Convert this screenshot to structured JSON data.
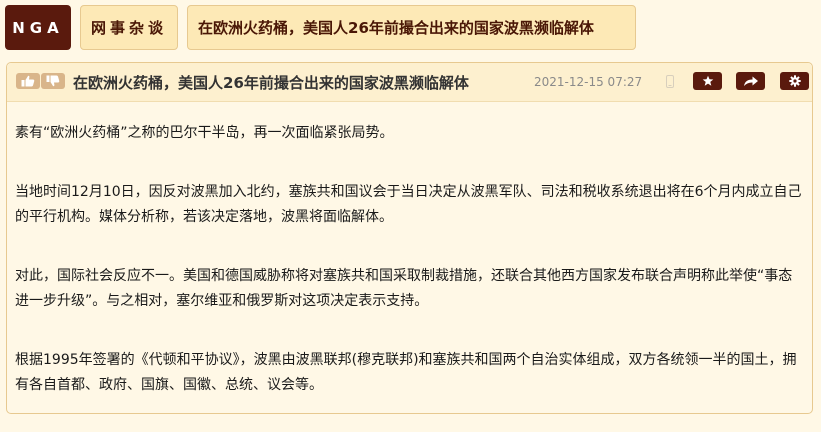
{
  "breadcrumb": {
    "site": "NGA",
    "forum": "网事杂谈",
    "thread_title": "在欧洲火药桶，美国人26年前撮合出来的国家波黑濒临解体"
  },
  "post": {
    "title": "在欧洲火药桶，美国人26年前撮合出来的国家波黑濒临解体",
    "time": "2021-12-15 07:27",
    "paragraphs": [
      "素有“欧洲火药桶”之称的巴尔干半岛，再一次面临紧张局势。",
      "当地时间12月10日，因反对波黑加入北约，塞族共和国议会于当日决定从波黑军队、司法和税收系统退出将在6个月内成立自己的平行机构。媒体分析称，若该决定落地，波黑将面临解体。",
      "对此，国际社会反应不一。美国和德国威胁称将对塞族共和国采取制裁措施，还联合其他西方国家发布联合声明称此举使“事态进一步升级”。与之相对，塞尔维亚和俄罗斯对这项决定表示支持。",
      "根据1995年签署的《代顿和平协议》，波黑由波黑联邦(穆克联邦)和塞族共和国两个自治实体组成，双方各统领一半的国土，拥有各自首都、政府、国旗、国徽、总统、议会等。"
    ]
  },
  "icons": {
    "vote_up": "thumbs-up-icon",
    "vote_down": "thumbs-down-icon",
    "device": "phone-icon",
    "favorite": "star-icon",
    "share": "share-icon",
    "settings": "gear-icon"
  },
  "colors": {
    "page_bg": "#fff8e6",
    "header_bg": "#fdf0cf",
    "brand_dark": "#5a1a0d",
    "crumb_bg": "#fde9b6",
    "vote_bg": "#d9b58a"
  }
}
